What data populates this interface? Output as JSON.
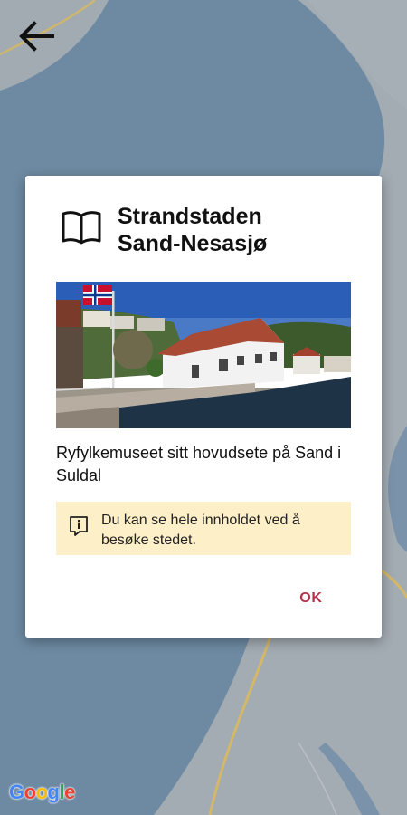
{
  "map": {
    "water_color": "#6e8aa3",
    "land_color": "#a3acb3",
    "road_color": "#d6b96a",
    "logo_text": "Google"
  },
  "toolbar": {
    "back_icon": "arrow-left-icon"
  },
  "dialog": {
    "icon": "book-icon",
    "title_line1": "Strandstaden",
    "title_line2": "Sand-Nesasjø",
    "description": "Ryfylkemuseet sitt hovudsete på Sand i Suldal",
    "notice": {
      "icon": "info-icon",
      "text": "Du kan se hele innholdet ved å besøke stedet.",
      "background": "#fdefc7"
    },
    "ok_label": "OK",
    "accent_color": "#b3324b"
  }
}
